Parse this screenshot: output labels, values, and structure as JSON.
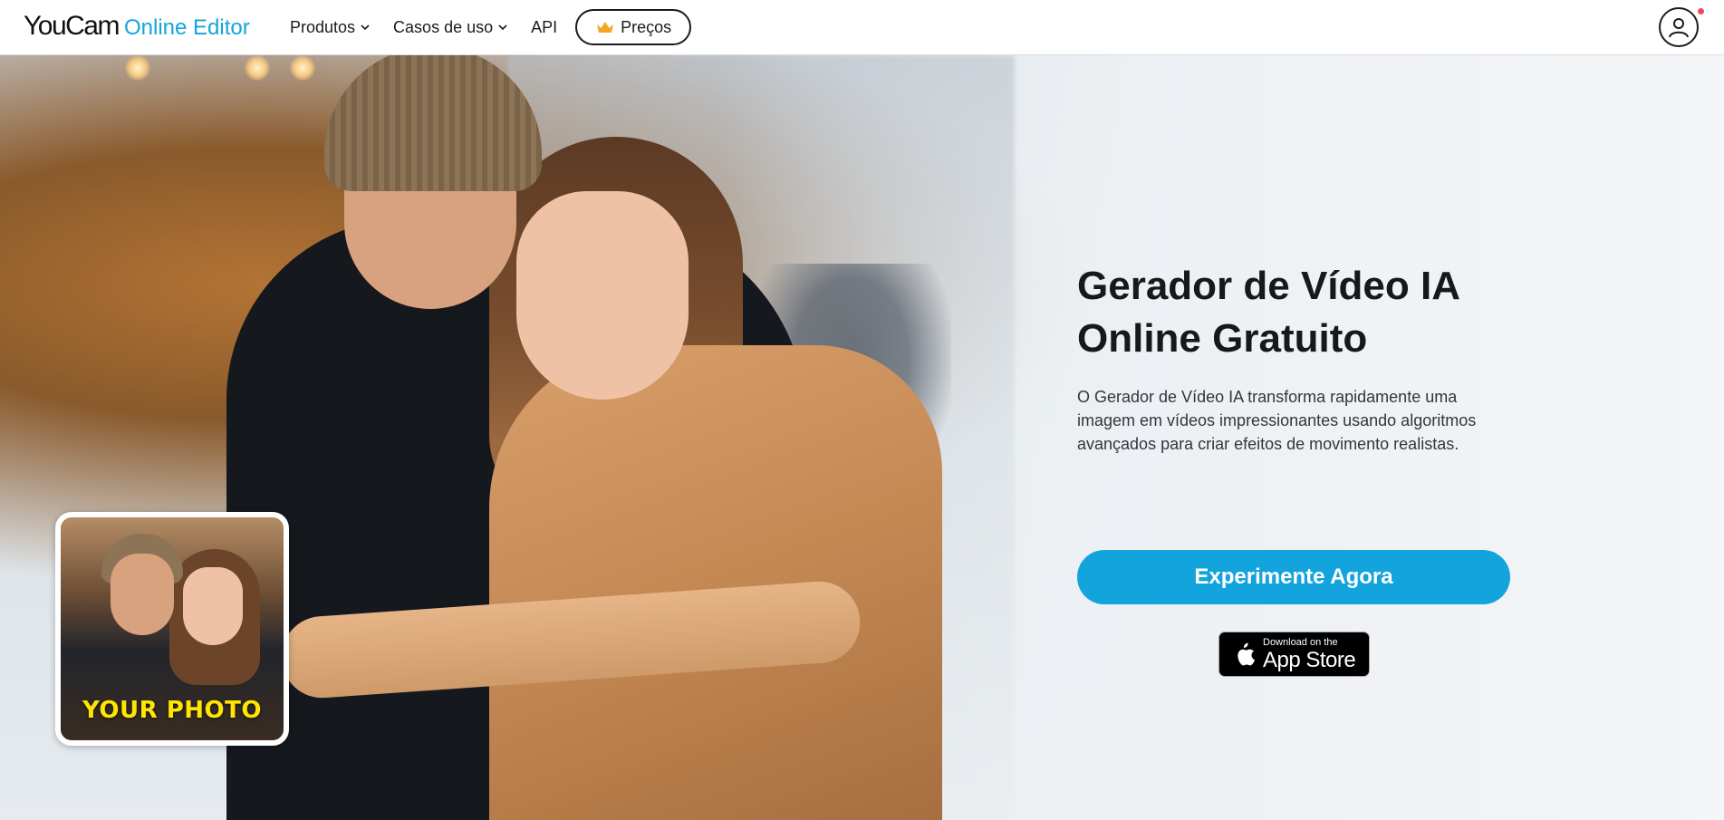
{
  "header": {
    "logo_main": "YouCam",
    "logo_sub": "Online Editor",
    "menu": [
      {
        "label": "Produtos",
        "has_dropdown": true
      },
      {
        "label": "Casos de uso",
        "has_dropdown": true
      },
      {
        "label": "API",
        "has_dropdown": false
      }
    ],
    "pricing_label": "Preços",
    "pricing_icon": "crown-icon",
    "account_icon": "user-account-icon"
  },
  "hero": {
    "title_line1": "Gerador de Vídeo IA",
    "title_line2": "Online Gratuito",
    "description": "O Gerador de Vídeo IA transforma rapidamente uma imagem em vídeos impressionantes usando algoritmos avançados para criar efeitos de movimento realistas.",
    "cta_label": "Experimente Agora",
    "appstore_small": "Download on the",
    "appstore_big": "App Store",
    "photo_label": "YOUR PHOTO"
  },
  "colors": {
    "accent": "#13a4dd",
    "photo_label": "#ffe600",
    "crown": "#f5a623",
    "notification_dot": "#ea4b57"
  }
}
